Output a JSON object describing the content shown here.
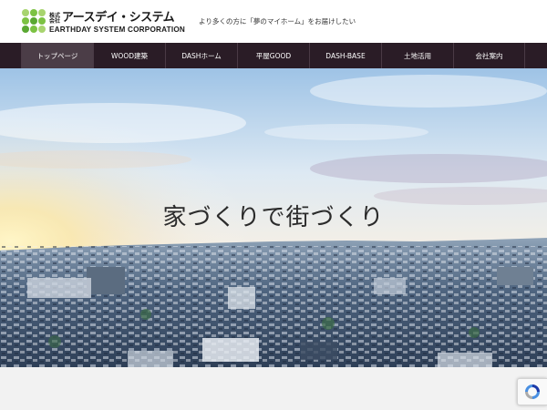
{
  "brand": {
    "kabushiki": "株式会社",
    "name": "アースデイ・システム",
    "english": "EARTHDAY SYSTEM CORPORATION",
    "tagline": "より多くの方に「夢のマイホーム」をお届けしたい",
    "colors": [
      "#7cc243",
      "#a8d46f",
      "#5aa832"
    ]
  },
  "nav": {
    "items": [
      {
        "label": "トップページ",
        "active": true
      },
      {
        "label": "WOOD建築"
      },
      {
        "label": "DASHホーム"
      },
      {
        "label": "平屋GOOD"
      },
      {
        "label": "DASH-BASE"
      },
      {
        "label": "土地活用"
      },
      {
        "label": "会社案内"
      }
    ]
  },
  "hero": {
    "title": "家づくりで街づくり"
  },
  "recaptcha": {
    "icon": "recaptcha-icon"
  }
}
